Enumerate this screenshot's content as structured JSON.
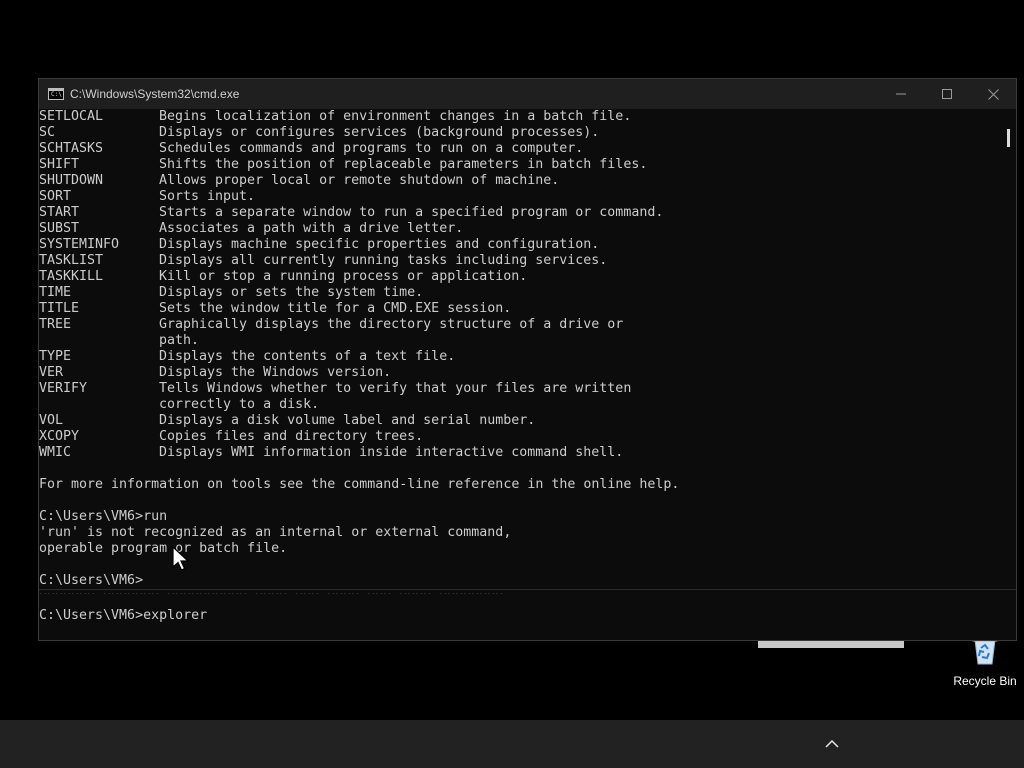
{
  "window": {
    "title": "C:\\Windows\\System32\\cmd.exe",
    "icon": "cmd-app-icon",
    "icon_text": "C:\\",
    "controls": [
      "minimize-icon",
      "maximize-icon",
      "close-icon"
    ]
  },
  "commands": [
    {
      "name": "SETLOCAL",
      "desc": "Begins localization of environment changes in a batch file."
    },
    {
      "name": "SC",
      "desc": "Displays or configures services (background processes)."
    },
    {
      "name": "SCHTASKS",
      "desc": "Schedules commands and programs to run on a computer."
    },
    {
      "name": "SHIFT",
      "desc": "Shifts the position of replaceable parameters in batch files."
    },
    {
      "name": "SHUTDOWN",
      "desc": "Allows proper local or remote shutdown of machine."
    },
    {
      "name": "SORT",
      "desc": "Sorts input."
    },
    {
      "name": "START",
      "desc": "Starts a separate window to run a specified program or command."
    },
    {
      "name": "SUBST",
      "desc": "Associates a path with a drive letter."
    },
    {
      "name": "SYSTEMINFO",
      "desc": "Displays machine specific properties and configuration."
    },
    {
      "name": "TASKLIST",
      "desc": "Displays all currently running tasks including services."
    },
    {
      "name": "TASKKILL",
      "desc": "Kill or stop a running process or application."
    },
    {
      "name": "TIME",
      "desc": "Displays or sets the system time."
    },
    {
      "name": "TITLE",
      "desc": "Sets the window title for a CMD.EXE session."
    },
    {
      "name": "TREE",
      "desc": "Graphically displays the directory structure of a drive or"
    },
    {
      "name": "",
      "desc": "path."
    },
    {
      "name": "TYPE",
      "desc": "Displays the contents of a text file."
    },
    {
      "name": "VER",
      "desc": "Displays the Windows version."
    },
    {
      "name": "VERIFY",
      "desc": "Tells Windows whether to verify that your files are written"
    },
    {
      "name": "",
      "desc": "correctly to a disk."
    },
    {
      "name": "VOL",
      "desc": "Displays a disk volume label and serial number."
    },
    {
      "name": "XCOPY",
      "desc": "Copies files and directory trees."
    },
    {
      "name": "WMIC",
      "desc": "Displays WMI information inside interactive command shell."
    }
  ],
  "console_tail": {
    "help_note": "For more information on tools see the command-line reference in the online help.",
    "prompt_run": "C:\\Users\\VM6>run",
    "error_line1": "'run' is not recognized as an internal or external command,",
    "error_line2": "operable program or batch file.",
    "prompt_empty": "C:\\Users\\VM6>"
  },
  "bottom_pane": {
    "prompt_explorer": "C:\\Users\\VM6>explorer"
  },
  "desktop": {
    "recycle_bin_label": "Recycle Bin"
  },
  "taskbar": {
    "tray_icon": "chevron-up-icon"
  },
  "colors": {
    "console_bg": "#0c0c0c",
    "console_text": "#cccccc",
    "titlebar_bg": "#1f1f1f",
    "taskbar_bg": "#222222"
  }
}
